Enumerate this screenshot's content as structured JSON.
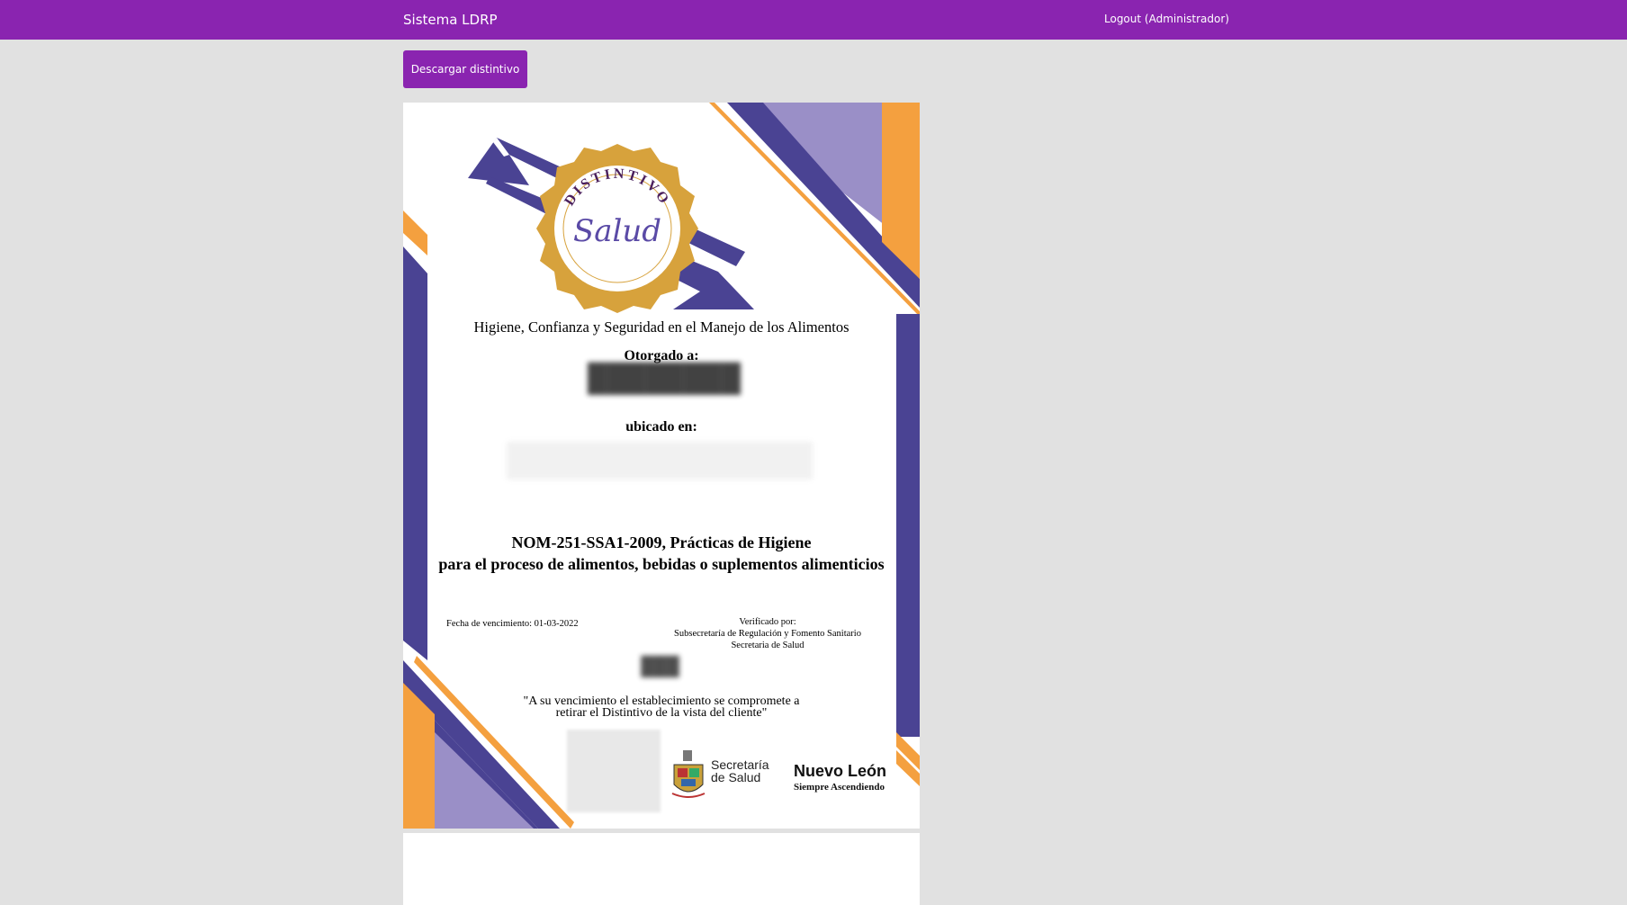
{
  "navbar": {
    "brand": "Sistema LDRP",
    "logout_label": "Logout (Administrador)"
  },
  "toolbar": {
    "download_label": "Descargar distintivo"
  },
  "certificate": {
    "seal_top_text": "DISTINTIVO",
    "seal_center_text": "Salud",
    "tagline": "Higiene, Confianza y Seguridad en el Manejo de los Alimentos",
    "awarded_label": "Otorgado a:",
    "located_label": "ubicado en:",
    "norm_line1": "NOM-251-SSA1-2009, Prácticas de Higiene",
    "norm_line2": "para el proceso de alimentos, bebidas o suplementos alimenticios",
    "expiry": "Fecha de vencimiento: 01-03-2022",
    "verified_by": "Verificado por:",
    "verified_org1": "Subsecretaría de Regulación y Fomento Sanitario",
    "verified_org2": "Secretaria de Salud",
    "quote_line1": "\"A su vencimiento el establecimiento se compromete a",
    "quote_line2": "retirar el Distintivo de la vista del cliente\"",
    "logo_sec_line1": "Secretaría",
    "logo_sec_line2": "de Salud",
    "logo_nl_title": "Nuevo León",
    "logo_nl_subtitle": "Siempre Ascendiendo"
  },
  "colors": {
    "primary": "#8a24b0",
    "cert_purple": "#4a4393",
    "cert_lavender": "#9a8fc7",
    "cert_orange": "#f4a03f",
    "seal_gold": "#d7a23c"
  }
}
